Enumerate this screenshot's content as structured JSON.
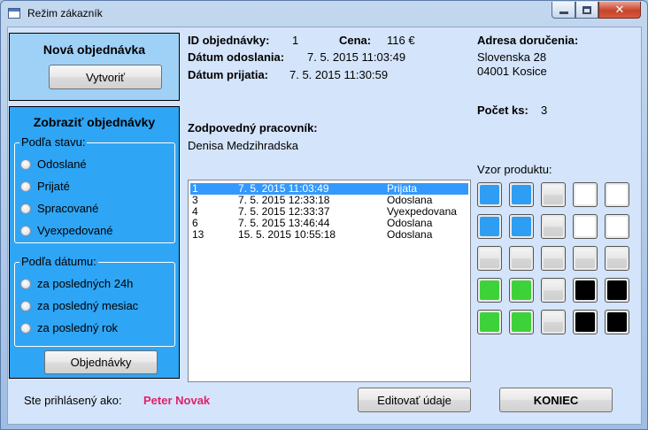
{
  "window": {
    "title": "Režim zákazník"
  },
  "new_order": {
    "title": "Nová objednávka",
    "create_button": "Vytvoriť"
  },
  "show_orders": {
    "title": "Zobraziť objednávky",
    "status_group": {
      "legend": "Podľa stavu:",
      "options": [
        "Odoslané",
        "Prijaté",
        "Spracované",
        "Vyexpedované"
      ]
    },
    "date_group": {
      "legend": "Podľa dátumu:",
      "options": [
        "za posledných 24h",
        "za posledný mesiac",
        "za posledný rok"
      ]
    },
    "orders_button": "Objednávky"
  },
  "login": {
    "label": "Ste prihlásený ako:",
    "user": "Peter Novak",
    "user_color": "#e0206a"
  },
  "order": {
    "id_label": "ID objednávky:",
    "id_value": "1",
    "price_label": "Cena:",
    "price_value": "116 €",
    "sent_label": "Dátum odoslania:",
    "sent_value": "7. 5. 2015 11:03:49",
    "received_label": "Dátum prijatia:",
    "received_value": "7. 5. 2015 11:30:59",
    "address_label": "Adresa doručenia:",
    "address_line1": "Slovenska 28",
    "address_line2": "04001 Kosice",
    "count_label": "Počet ks:",
    "count_value": "3",
    "employee_label": "Zodpovedný pracovník:",
    "employee_value": "Denisa Medzihradska",
    "pattern_label": "Vzor produktu:"
  },
  "orders_list": [
    {
      "id": "1",
      "date": "7. 5. 2015 11:03:49",
      "state": "Prijata",
      "selected": true
    },
    {
      "id": "3",
      "date": "7. 5. 2015 12:33:18",
      "state": "Odoslana",
      "selected": false
    },
    {
      "id": "4",
      "date": "7. 5. 2015 12:33:37",
      "state": "Vyexpedovana",
      "selected": false
    },
    {
      "id": "6",
      "date": "7. 5. 2015 13:46:44",
      "state": "Odoslana",
      "selected": false
    },
    {
      "id": "13",
      "date": "15. 5. 2015 10:55:18",
      "state": "Odoslana",
      "selected": false
    }
  ],
  "product_pattern": [
    [
      "blue",
      "blue",
      "gray",
      "white",
      "white"
    ],
    [
      "blue",
      "blue",
      "gray",
      "white",
      "white"
    ],
    [
      "gray",
      "gray",
      "gray",
      "gray",
      "gray"
    ],
    [
      "green",
      "green",
      "gray",
      "black",
      "black"
    ],
    [
      "green",
      "green",
      "gray",
      "black",
      "black"
    ]
  ],
  "buttons": {
    "edit": "Editovať údaje",
    "end": "KONIEC"
  }
}
